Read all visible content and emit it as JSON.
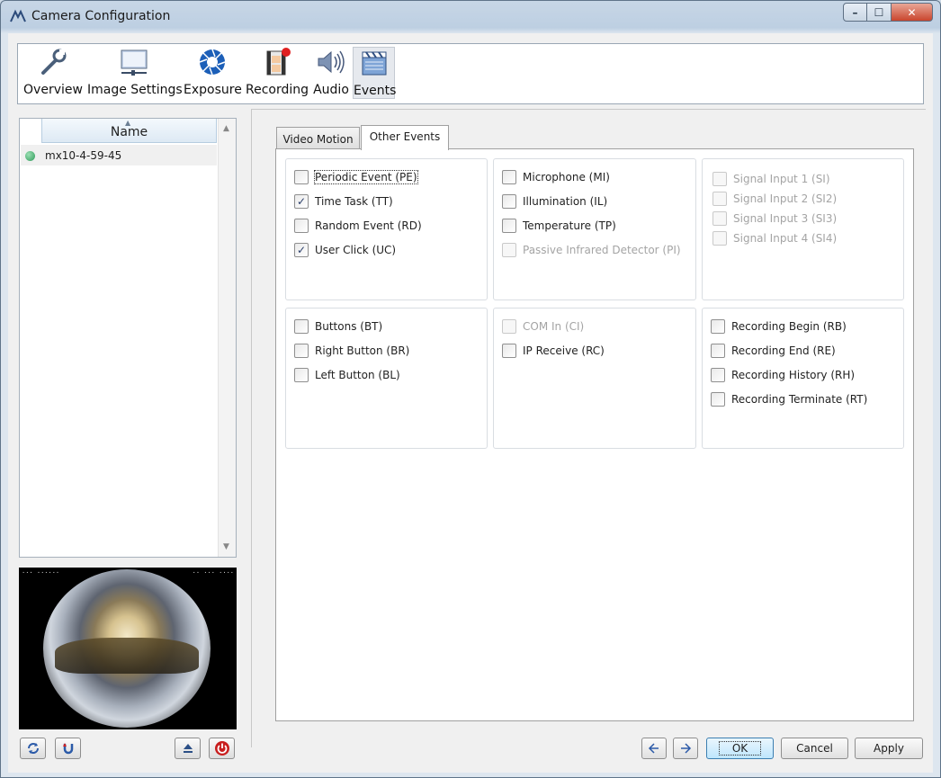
{
  "window": {
    "title": "Camera Configuration",
    "caption_buttons": {
      "minimize": "–",
      "maximize": "☐",
      "close": "✕"
    }
  },
  "toolbar": {
    "items": [
      {
        "label": "Overview",
        "icon": "wrench-icon"
      },
      {
        "label": "Image Settings",
        "icon": "image-settings-icon"
      },
      {
        "label": "Exposure",
        "icon": "aperture-icon"
      },
      {
        "label": "Recording",
        "icon": "film-record-icon"
      },
      {
        "label": "Audio",
        "icon": "speaker-icon"
      },
      {
        "label": "Events",
        "icon": "clapperboard-icon"
      }
    ],
    "active": "Events"
  },
  "camera_list": {
    "header": "Name",
    "rows": [
      {
        "name": "mx10-4-59-45",
        "status_color": "#2e9a5a"
      }
    ]
  },
  "tabs": [
    {
      "label": "Video Motion"
    },
    {
      "label": "Other Events"
    }
  ],
  "active_tab": "Other Events",
  "groups": {
    "g1": [
      {
        "label": "Periodic Event (PE)",
        "checked": false,
        "enabled": true
      },
      {
        "label": "Time Task (TT)",
        "checked": true,
        "enabled": true
      },
      {
        "label": "Random Event (RD)",
        "checked": false,
        "enabled": true
      },
      {
        "label": "User Click (UC)",
        "checked": true,
        "enabled": true
      }
    ],
    "g2": [
      {
        "label": "Microphone (MI)",
        "checked": false,
        "enabled": true
      },
      {
        "label": "Illumination (IL)",
        "checked": false,
        "enabled": true
      },
      {
        "label": "Temperature (TP)",
        "checked": false,
        "enabled": true
      },
      {
        "label": "Passive Infrared Detector (PI)",
        "checked": false,
        "enabled": false
      }
    ],
    "g3": [
      {
        "label": "Signal Input 1 (SI)",
        "checked": false,
        "enabled": false
      },
      {
        "label": "Signal Input 2 (SI2)",
        "checked": false,
        "enabled": false
      },
      {
        "label": "Signal Input 3 (SI3)",
        "checked": false,
        "enabled": false
      },
      {
        "label": "Signal Input 4 (SI4)",
        "checked": false,
        "enabled": false
      }
    ],
    "g4": [
      {
        "label": "Buttons (BT)",
        "checked": false,
        "enabled": true
      },
      {
        "label": "Right Button (BR)",
        "checked": false,
        "enabled": true
      },
      {
        "label": "Left Button (BL)",
        "checked": false,
        "enabled": true
      }
    ],
    "g5": [
      {
        "label": "COM In (CI)",
        "checked": false,
        "enabled": false
      },
      {
        "label": "IP Receive (RC)",
        "checked": false,
        "enabled": true
      }
    ],
    "g6": [
      {
        "label": "Recording Begin (RB)",
        "checked": false,
        "enabled": true
      },
      {
        "label": "Recording End (RE)",
        "checked": false,
        "enabled": true
      },
      {
        "label": "Recording History (RH)",
        "checked": false,
        "enabled": true
      },
      {
        "label": "Recording Terminate (RT)",
        "checked": false,
        "enabled": true
      }
    ]
  },
  "footer": {
    "ok": "OK",
    "cancel": "Cancel",
    "apply": "Apply"
  },
  "icons": {
    "side_buttons": [
      "refresh-icon",
      "reconnect-icon",
      "eject-icon",
      "power-icon"
    ],
    "nav_buttons": [
      "back-arrow-icon",
      "forward-arrow-icon"
    ]
  }
}
